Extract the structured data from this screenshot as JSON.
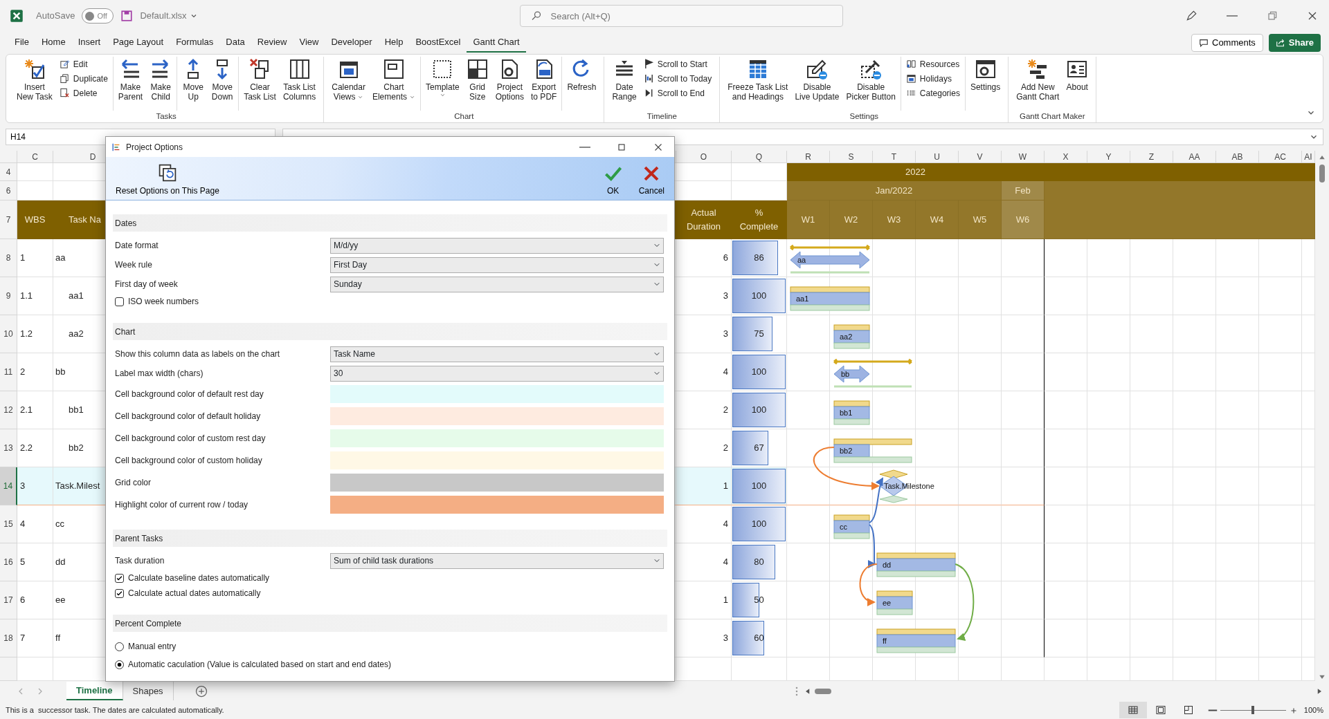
{
  "titlebar": {
    "autosave": {
      "label": "AutoSave",
      "on": false,
      "state": "Off"
    },
    "filename": "Default.xlsx",
    "search": {
      "placeholder": "Search (Alt+Q)"
    }
  },
  "menu": {
    "tabs": [
      {
        "label": "File",
        "selected": false
      },
      {
        "label": "Home",
        "selected": false
      },
      {
        "label": "Insert",
        "selected": false
      },
      {
        "label": "Page Layout",
        "selected": false
      },
      {
        "label": "Formulas",
        "selected": false
      },
      {
        "label": "Data",
        "selected": false
      },
      {
        "label": "Review",
        "selected": false
      },
      {
        "label": "View",
        "selected": false
      },
      {
        "label": "Developer",
        "selected": false
      },
      {
        "label": "Help",
        "selected": false
      },
      {
        "label": "BoostExcel",
        "selected": false
      },
      {
        "label": "Gantt Chart",
        "selected": true
      }
    ],
    "comments": "Comments",
    "share": "Share"
  },
  "ribbon": {
    "groups": [
      {
        "label": "Tasks",
        "clusters": [
          [
            {
              "kind": "large",
              "label": "Insert\nNew Task",
              "dropdown": false
            },
            {
              "kind": "stack",
              "items": [
                "Edit",
                "Duplicate",
                "Delete"
              ]
            }
          ],
          [
            {
              "kind": "large",
              "label": "Make\nParent",
              "dropdown": false
            },
            {
              "kind": "large",
              "label": "Make\nChild",
              "dropdown": false
            }
          ],
          [
            {
              "kind": "large",
              "label": "Move\nUp",
              "dropdown": false
            },
            {
              "kind": "large",
              "label": "Move\nDown",
              "dropdown": false
            }
          ],
          [
            {
              "kind": "large",
              "label": "Clear\nTask List",
              "dropdown": false
            },
            {
              "kind": "large",
              "label": "Task List\nColumns",
              "dropdown": false
            }
          ]
        ]
      },
      {
        "label": "Chart",
        "clusters": [
          [
            {
              "kind": "large",
              "label": "Calendar\nViews",
              "dropdown": true
            },
            {
              "kind": "large",
              "label": "Chart\nElements",
              "dropdown": true
            }
          ],
          [
            {
              "kind": "large",
              "label": "Template",
              "dropdown": true
            },
            {
              "kind": "large",
              "label": "Grid\nSize",
              "dropdown": false
            },
            {
              "kind": "large",
              "label": "Project\nOptions",
              "dropdown": false
            },
            {
              "kind": "large",
              "label": "Export\nto PDF",
              "dropdown": false
            }
          ],
          [
            {
              "kind": "large",
              "label": "Refresh",
              "dropdown": false
            }
          ]
        ]
      },
      {
        "label": "Timeline",
        "clusters": [
          [
            {
              "kind": "large",
              "label": "Date\nRange",
              "dropdown": false
            },
            {
              "kind": "stack",
              "items": [
                "Scroll to Start",
                "Scroll to Today",
                "Scroll to End"
              ]
            }
          ]
        ]
      },
      {
        "label": "Settings",
        "clusters": [
          [
            {
              "kind": "large",
              "label": "Freeze Task List\nand Headings",
              "dropdown": false
            },
            {
              "kind": "large",
              "label": "Disable\nLive Update",
              "dropdown": false
            },
            {
              "kind": "large",
              "label": "Disable\nPicker Button",
              "dropdown": false
            }
          ],
          [
            {
              "kind": "stack",
              "items": [
                "Resources",
                "Holidays",
                "Categories"
              ]
            }
          ],
          [
            {
              "kind": "large",
              "label": "Settings",
              "dropdown": false
            }
          ]
        ]
      },
      {
        "label": "Gantt Chart Maker",
        "clusters": [
          [
            {
              "kind": "large",
              "label": "Add New\nGantt Chart",
              "dropdown": false
            },
            {
              "kind": "large",
              "label": "About",
              "dropdown": false
            }
          ]
        ]
      }
    ]
  },
  "formula_bar": {
    "name_box": "H14"
  },
  "sheet": {
    "columns": [
      "C",
      "D",
      "O",
      "Q",
      "R",
      "S",
      "T",
      "U",
      "V",
      "W",
      "X",
      "Y",
      "Z",
      "AA",
      "AB",
      "AC",
      "AI"
    ],
    "row_numbers": [
      "4",
      "6",
      "7",
      "8",
      "9",
      "10",
      "11",
      "12",
      "13",
      "14",
      "15",
      "16",
      "17",
      "18"
    ],
    "header": {
      "wbs": "WBS",
      "task": "Task Na",
      "actual": "Actual\nDuration",
      "complete": "%\nComplete"
    },
    "timeline": {
      "year": "2022",
      "months": [
        {
          "label": "Jan/2022",
          "weeks": [
            "W1",
            "W2",
            "W3",
            "W4",
            "W5"
          ]
        },
        {
          "label": "Feb",
          "weeks": [
            "W6"
          ]
        }
      ]
    },
    "tasks": [
      {
        "wbs": "1",
        "name": "aa",
        "actual_duration": "6",
        "complete": "86",
        "level": 0.86,
        "selected": false,
        "bar": {
          "kind": "summary",
          "label": "aa"
        },
        "children": [
          {
            "wbs": "1.1",
            "name": "aa1",
            "actual_duration": "3",
            "complete": "100",
            "level": 1,
            "selected": false,
            "bar": {
              "kind": "task",
              "label": "aa1"
            }
          },
          {
            "wbs": "1.2",
            "name": "aa2",
            "actual_duration": "3",
            "complete": "75",
            "level": 0.75,
            "selected": false,
            "bar": {
              "kind": "task",
              "label": "aa2"
            }
          }
        ]
      },
      {
        "wbs": "2",
        "name": "bb",
        "actual_duration": "4",
        "complete": "100",
        "level": 1,
        "selected": false,
        "bar": {
          "kind": "summary",
          "label": "bb"
        },
        "children": [
          {
            "wbs": "2.1",
            "name": "bb1",
            "actual_duration": "2",
            "complete": "100",
            "level": 1,
            "selected": false,
            "bar": {
              "kind": "task",
              "label": "bb1"
            }
          },
          {
            "wbs": "2.2",
            "name": "bb2",
            "actual_duration": "2",
            "complete": "67",
            "level": 0.67,
            "selected": false,
            "bar": {
              "kind": "task",
              "label": "bb2"
            }
          }
        ]
      },
      {
        "wbs": "3",
        "name": "Task.Milest",
        "actual_duration": "1",
        "complete": "100",
        "level": 1,
        "selected": true,
        "bar": {
          "kind": "milestone",
          "label": "Task.Milestone"
        }
      },
      {
        "wbs": "4",
        "name": "cc",
        "actual_duration": "4",
        "complete": "100",
        "level": 1,
        "selected": false,
        "bar": {
          "kind": "task",
          "label": "cc"
        }
      },
      {
        "wbs": "5",
        "name": "dd",
        "actual_duration": "4",
        "complete": "80",
        "level": 0.8,
        "selected": false,
        "bar": {
          "kind": "task",
          "label": "dd"
        }
      },
      {
        "wbs": "6",
        "name": "ee",
        "actual_duration": "1",
        "complete": "50",
        "level": 0.5,
        "selected": false,
        "bar": {
          "kind": "task",
          "label": "ee"
        }
      },
      {
        "wbs": "7",
        "name": "ff",
        "actual_duration": "3",
        "complete": "60",
        "level": 0.6,
        "selected": false,
        "bar": {
          "kind": "task",
          "label": "ff"
        }
      }
    ]
  },
  "dialog": {
    "title": "Project Options",
    "reset": "Reset Options on This Page",
    "ok": "OK",
    "cancel": "Cancel",
    "sections": [
      {
        "title": "Dates",
        "rows": [
          {
            "kind": "select",
            "label": "Date format",
            "value": "M/d/yy"
          },
          {
            "kind": "select",
            "label": "Week rule",
            "value": "First Day"
          },
          {
            "kind": "select",
            "label": "First day of week",
            "value": "Sunday"
          },
          {
            "kind": "checkbox",
            "label": "ISO week numbers",
            "checked": false
          }
        ]
      },
      {
        "title": "Chart",
        "rows": [
          {
            "kind": "select",
            "label": "Show this column data as labels on the chart",
            "value": "Task Name"
          },
          {
            "kind": "select",
            "label": "Label max width (chars)",
            "value": "30"
          },
          {
            "kind": "color",
            "label": "Cell background color of default rest day",
            "color": "#e3fbfb"
          },
          {
            "kind": "color",
            "label": "Cell background color of default holiday",
            "color": "#feebe0"
          },
          {
            "kind": "color",
            "label": "Cell background color of custom rest day",
            "color": "#e6fbea"
          },
          {
            "kind": "color",
            "label": "Cell background color of custom holiday",
            "color": "#fff8e6"
          },
          {
            "kind": "color",
            "label": "Grid color",
            "color": "#c8c8c8"
          },
          {
            "kind": "color",
            "label": "Highlight color of current row / today",
            "color": "#f4ae84"
          }
        ]
      },
      {
        "title": "Parent Tasks",
        "rows": [
          {
            "kind": "select",
            "label": "Task duration",
            "value": "Sum of child task durations"
          },
          {
            "kind": "checkbox",
            "label": "Calculate baseline dates automatically",
            "checked": true
          },
          {
            "kind": "checkbox",
            "label": "Calculate actual dates automatically",
            "checked": true
          }
        ]
      },
      {
        "title": "Percent Complete",
        "rows": [
          {
            "kind": "radio",
            "label": "Manual entry",
            "selected": false
          },
          {
            "kind": "radio",
            "label": "Automatic caculation (Value is calculated based on start and end dates)",
            "selected": true
          }
        ]
      }
    ]
  },
  "sheet_tabs": [
    {
      "label": "Timeline",
      "selected": true
    },
    {
      "label": "Shapes",
      "selected": false
    }
  ],
  "status_bar": {
    "message": "This is a  successor task. The dates are calculated automatically.",
    "views": [
      {
        "selected": true
      },
      {
        "selected": false
      },
      {
        "selected": false
      }
    ],
    "zoom": {
      "level": 0.5,
      "label": "100%"
    }
  }
}
